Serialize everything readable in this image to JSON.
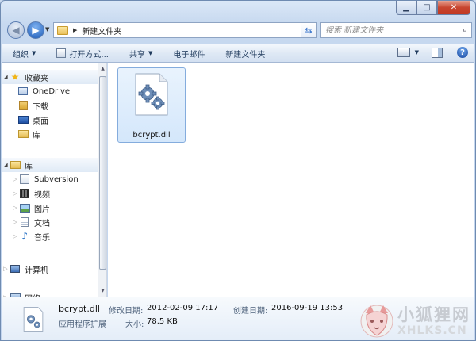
{
  "window": {
    "caption": {
      "minimize": "▁",
      "maximize": "□",
      "close": "✕"
    }
  },
  "address_bar": {
    "path": "新建文件夹",
    "refresh_icon": "refresh-icon",
    "search_placeholder": "搜索 新建文件夹"
  },
  "toolbar": {
    "items": [
      {
        "label": "组织",
        "has_menu": true
      },
      {
        "label": "打开方式...",
        "has_menu": false
      },
      {
        "label": "共享",
        "has_menu": true
      },
      {
        "label": "电子邮件",
        "has_menu": false
      },
      {
        "label": "新建文件夹",
        "has_menu": false
      }
    ],
    "help": "?"
  },
  "nav": {
    "favorites": {
      "label": "收藏夹",
      "items": [
        {
          "label": "OneDrive",
          "icon": "onedrive-icon"
        },
        {
          "label": "下载",
          "icon": "downloads-icon"
        },
        {
          "label": "桌面",
          "icon": "desktop-icon"
        },
        {
          "label": "库",
          "icon": "library-icon"
        }
      ]
    },
    "libraries": {
      "label": "库",
      "items": [
        {
          "label": "Subversion",
          "icon": "subversion-icon"
        },
        {
          "label": "视频",
          "icon": "video-icon"
        },
        {
          "label": "图片",
          "icon": "pictures-icon"
        },
        {
          "label": "文档",
          "icon": "documents-icon"
        },
        {
          "label": "音乐",
          "icon": "music-icon"
        }
      ]
    },
    "computer": {
      "label": "计算机"
    },
    "network": {
      "label": "网络"
    }
  },
  "files": [
    {
      "name": "bcrypt.dll",
      "icon": "dll-gear-icon",
      "selected": true
    }
  ],
  "details": {
    "name": "bcrypt.dll",
    "type": "应用程序扩展",
    "modified_label": "修改日期:",
    "modified_value": "2012-02-09 17:17",
    "created_label": "创建日期:",
    "created_value": "2016-09-19 13:53",
    "size_label": "大小:",
    "size_value": "78.5 KB"
  },
  "watermark": {
    "cn": "小狐狸网",
    "en": "XHLKS.CN"
  }
}
